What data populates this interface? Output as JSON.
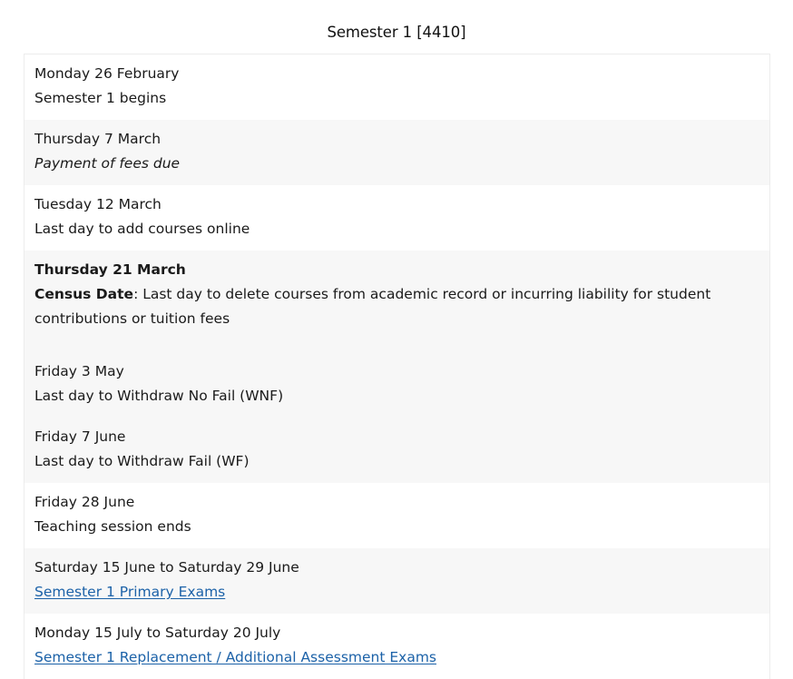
{
  "page": {
    "title": "Semester 1 [4410]"
  },
  "events": [
    {
      "date": "Monday 26 February",
      "description": "Semester 1 begins"
    },
    {
      "date": "Thursday 7 March",
      "description": "Payment of fees due"
    },
    {
      "date": "Tuesday 12 March",
      "description": "Last day to add courses online"
    },
    {
      "date": "Thursday 21 March",
      "description_lead": "Census Date",
      "description": ": Last day to delete courses from academic record or incurring liability for student contributions or tuition fees"
    },
    {
      "date": "Friday 3 May",
      "description": "Last day to Withdraw No Fail (WNF)"
    },
    {
      "date": "Friday 7 June",
      "description": "Last day to Withdraw Fail (WF)"
    },
    {
      "date": "Friday 28 June",
      "description": "Teaching session ends"
    },
    {
      "date": "Saturday 15 June to Saturday 29 June",
      "link_text": "Semester 1 Primary Exams"
    },
    {
      "date": "Monday 15 July to Saturday 20 July",
      "link_text": "Semester 1 Replacement / Additional Assessment Exams"
    }
  ],
  "colors": {
    "link": "#1c62a8",
    "row_alt_bg": "#f7f7f7",
    "border": "#ececec"
  }
}
